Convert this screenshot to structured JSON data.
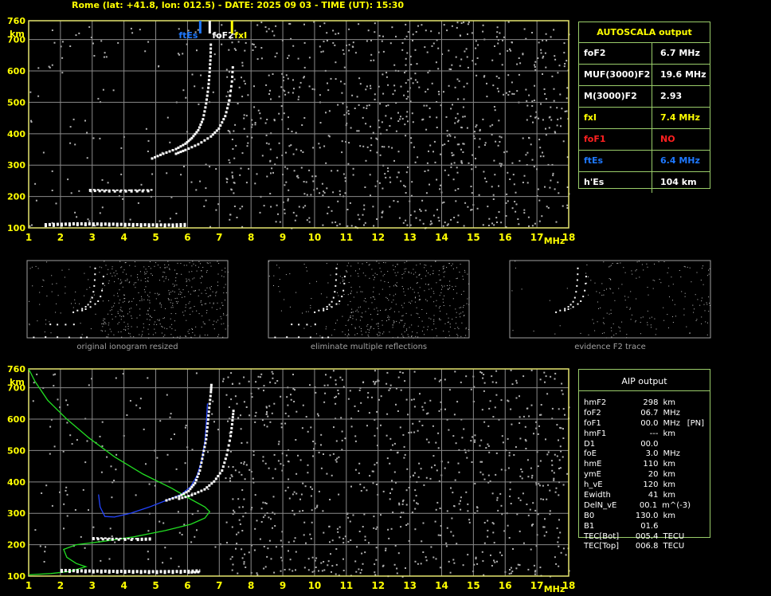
{
  "header": {
    "title": "Rome (lat: +41.8, lon: 012.5) - DATE: 2025 09 03 - TIME (UT): 15:30"
  },
  "colors": {
    "grid": "#8a8a8a",
    "frame": "#e5e56f",
    "trace": "#ffffff",
    "noise": "#b0b0b0",
    "fxI": "#ffff00",
    "ftEs": "#1e78ff",
    "foF1": "#ff2020",
    "profile_green": "#22dd22",
    "profile_blue": "#2244ff"
  },
  "autoscala": {
    "title": "AUTOSCALA output",
    "rows": [
      {
        "label": "foF2",
        "value": "6.7 MHz",
        "color": "#ffffff"
      },
      {
        "label": "MUF(3000)F2",
        "value": "19.6 MHz",
        "color": "#ffffff"
      },
      {
        "label": "M(3000)F2",
        "value": "2.93",
        "color": "#ffffff"
      },
      {
        "label": "fxI",
        "value": "7.4 MHz",
        "color": "#ffff00"
      },
      {
        "label": "foF1",
        "value": "NO",
        "color": "#ff2020"
      },
      {
        "label": "ftEs",
        "value": "6.4 MHz",
        "color": "#1e78ff"
      },
      {
        "label": "h'Es",
        "value": "104     km",
        "color": "#ffffff"
      }
    ]
  },
  "aip": {
    "title": "AIP output",
    "rows": [
      {
        "name": "hmF2",
        "value": "298",
        "unit": "km",
        "extra": ""
      },
      {
        "name": "foF2",
        "value": "06.7",
        "unit": "MHz",
        "extra": ""
      },
      {
        "name": "foF1",
        "value": "00.0",
        "unit": "MHz",
        "extra": "[PN]"
      },
      {
        "name": "hmF1",
        "value": "---",
        "unit": "km",
        "extra": ""
      },
      {
        "name": "D1",
        "value": "00.0",
        "unit": "",
        "extra": ""
      },
      {
        "name": "foE",
        "value": "3.0",
        "unit": "MHz",
        "extra": ""
      },
      {
        "name": "hmE",
        "value": "110",
        "unit": "km",
        "extra": ""
      },
      {
        "name": "ymE",
        "value": "20",
        "unit": "km",
        "extra": ""
      },
      {
        "name": "h_vE",
        "value": "120",
        "unit": "km",
        "extra": ""
      },
      {
        "name": "Ewidth",
        "value": "41",
        "unit": "km",
        "extra": ""
      },
      {
        "name": "DelN_vE",
        "value": "00.1",
        "unit": "m^(-3)",
        "extra": ""
      },
      {
        "name": "B0",
        "value": "130.0",
        "unit": "km",
        "extra": ""
      },
      {
        "name": "B1",
        "value": "01.6",
        "unit": "",
        "extra": ""
      },
      {
        "name": "TEC[Bot]",
        "value": "005.4",
        "unit": "TECU",
        "extra": ""
      },
      {
        "name": "TEC[Top]",
        "value": "006.8",
        "unit": "TECU",
        "extra": ""
      }
    ]
  },
  "thumbnails": [
    {
      "caption": "original ionogram resized"
    },
    {
      "caption": "eliminate multiple reflections"
    },
    {
      "caption": "evidence F2 trace"
    }
  ],
  "chart_data": [
    {
      "type": "scatter",
      "name": "AUTOSCALA ionogram",
      "xlabel": "MHz",
      "ylabel": "km",
      "xlim": [
        1,
        18
      ],
      "ylim": [
        100,
        760
      ],
      "x_ticks": [
        "1",
        "2",
        "3",
        "4",
        "5",
        "6",
        "7",
        "8",
        "9",
        "10",
        "11",
        "12",
        "13",
        "14",
        "15",
        "16",
        "17",
        "18"
      ],
      "y_ticks": [
        "100",
        "200",
        "300",
        "400",
        "500",
        "600",
        "700",
        "760"
      ],
      "grid": true,
      "markers": [
        {
          "label": "ftEs",
          "x": 6.4,
          "color": "#1e78ff"
        },
        {
          "label": "foF2",
          "x": 6.7,
          "color": "#ffffff"
        },
        {
          "label": "fxI",
          "x": 7.4,
          "color": "#ffff00"
        }
      ],
      "series": [
        {
          "name": "o-trace",
          "points": [
            [
              4.85,
              325
            ],
            [
              5.2,
              340
            ],
            [
              5.6,
              355
            ],
            [
              5.9,
              372
            ],
            [
              6.1,
              390
            ],
            [
              6.3,
              415
            ],
            [
              6.45,
              450
            ],
            [
              6.55,
              500
            ],
            [
              6.62,
              550
            ],
            [
              6.66,
              600
            ],
            [
              6.69,
              650
            ],
            [
              6.7,
              700
            ]
          ]
        },
        {
          "name": "x-trace",
          "points": [
            [
              5.6,
              340
            ],
            [
              5.9,
              352
            ],
            [
              6.3,
              370
            ],
            [
              6.7,
              395
            ],
            [
              6.95,
              420
            ],
            [
              7.15,
              460
            ],
            [
              7.28,
              510
            ],
            [
              7.36,
              570
            ],
            [
              7.4,
              630
            ]
          ]
        },
        {
          "name": "Es",
          "points": [
            [
              1.5,
              110
            ],
            [
              2.5,
              113
            ],
            [
              3.5,
              112
            ],
            [
              4.5,
              110
            ],
            [
              5.5,
              109
            ],
            [
              6.0,
              111
            ]
          ]
        },
        {
          "name": "Es-2nd",
          "points": [
            [
              2.9,
              222
            ],
            [
              3.5,
              220
            ],
            [
              4.2,
              220
            ],
            [
              4.9,
              221
            ]
          ]
        }
      ]
    },
    {
      "type": "line",
      "name": "AIP ionogram with profile",
      "xlabel": "MHz",
      "ylabel": "km",
      "xlim": [
        1,
        18
      ],
      "ylim": [
        100,
        760
      ],
      "x_ticks": [
        "1",
        "2",
        "3",
        "4",
        "5",
        "6",
        "7",
        "8",
        "9",
        "10",
        "11",
        "12",
        "13",
        "14",
        "15",
        "16",
        "17",
        "18"
      ],
      "y_ticks": [
        "100",
        "200",
        "300",
        "400",
        "500",
        "600",
        "700",
        "760"
      ],
      "grid": true,
      "series": [
        {
          "name": "electron density profile",
          "color": "#22dd22",
          "points": [
            [
              1.0,
              760
            ],
            [
              1.2,
              720
            ],
            [
              1.6,
              660
            ],
            [
              2.2,
              600
            ],
            [
              2.9,
              540
            ],
            [
              3.7,
              480
            ],
            [
              4.6,
              425
            ],
            [
              5.5,
              380
            ],
            [
              6.1,
              345
            ],
            [
              6.55,
              320
            ],
            [
              6.7,
              305
            ],
            [
              6.55,
              285
            ],
            [
              6.1,
              265
            ],
            [
              5.3,
              245
            ],
            [
              4.3,
              225
            ],
            [
              3.3,
              210
            ],
            [
              2.5,
              200
            ],
            [
              2.1,
              185
            ],
            [
              2.2,
              160
            ],
            [
              2.5,
              140
            ],
            [
              2.8,
              130
            ],
            [
              2.3,
              115
            ],
            [
              1.7,
              108
            ],
            [
              1.0,
              104
            ]
          ]
        },
        {
          "name": "virtual height (model)",
          "color": "#2244ff",
          "points": [
            [
              3.2,
              360
            ],
            [
              3.25,
              320
            ],
            [
              3.4,
              290
            ],
            [
              3.7,
              288
            ],
            [
              4.2,
              300
            ],
            [
              4.8,
              320
            ],
            [
              5.3,
              340
            ],
            [
              5.8,
              360
            ],
            [
              6.1,
              385
            ],
            [
              6.3,
              420
            ],
            [
              6.45,
              470
            ],
            [
              6.55,
              530
            ],
            [
              6.6,
              600
            ],
            [
              6.63,
              650
            ]
          ]
        },
        {
          "name": "o-trace",
          "color": "#ffffff",
          "points": [
            [
              5.3,
              345
            ],
            [
              5.7,
              358
            ],
            [
              6.0,
              375
            ],
            [
              6.2,
              400
            ],
            [
              6.35,
              440
            ],
            [
              6.45,
              490
            ],
            [
              6.55,
              540
            ],
            [
              6.6,
              590
            ],
            [
              6.65,
              640
            ],
            [
              6.7,
              690
            ],
            [
              6.72,
              720
            ]
          ]
        },
        {
          "name": "x-trace",
          "color": "#ffffff",
          "points": [
            [
              5.7,
              350
            ],
            [
              6.1,
              362
            ],
            [
              6.5,
              380
            ],
            [
              6.8,
              405
            ],
            [
              7.05,
              440
            ],
            [
              7.2,
              490
            ],
            [
              7.32,
              550
            ],
            [
              7.38,
              600
            ],
            [
              7.42,
              640
            ]
          ]
        },
        {
          "name": "Es",
          "color": "#ffffff",
          "points": [
            [
              2.0,
              118
            ],
            [
              3.0,
              116
            ],
            [
              4.0,
              115
            ],
            [
              5.0,
              114
            ],
            [
              6.0,
              115
            ],
            [
              6.4,
              117
            ]
          ]
        },
        {
          "name": "Es-2nd",
          "color": "#ffffff",
          "points": [
            [
              3.0,
              222
            ],
            [
              3.6,
              220
            ],
            [
              4.4,
              219
            ],
            [
              4.9,
              221
            ]
          ]
        }
      ]
    }
  ]
}
